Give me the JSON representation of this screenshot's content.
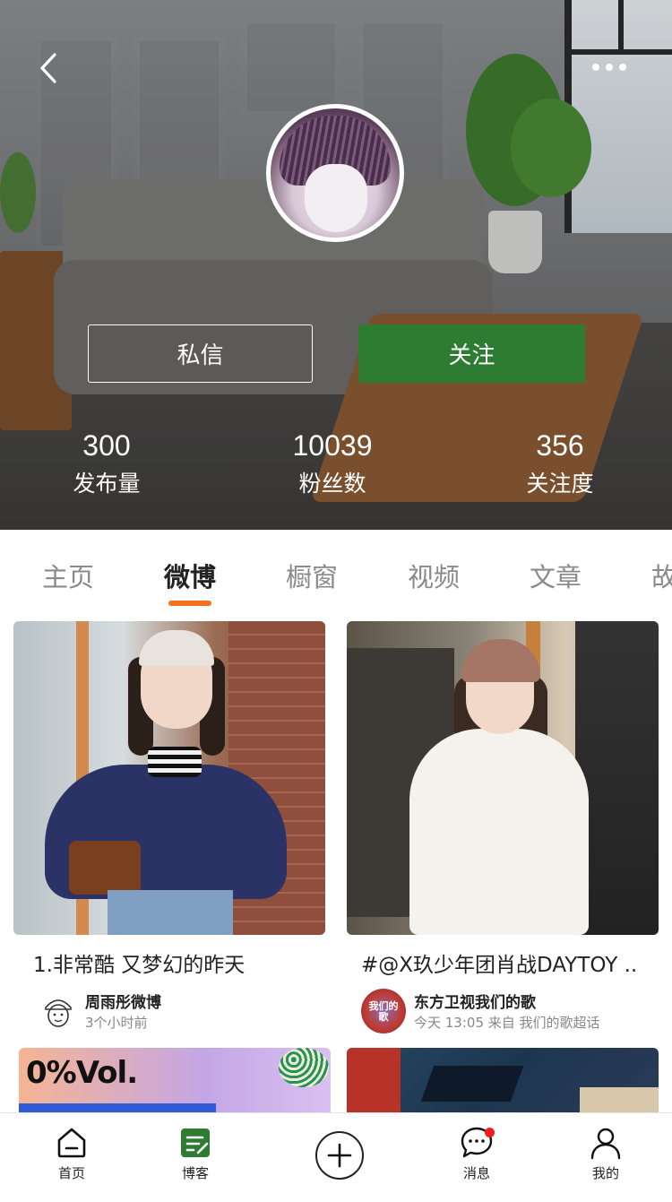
{
  "profile": {
    "message_label": "私信",
    "follow_label": "关注",
    "stats": [
      {
        "value": "300",
        "label": "发布量"
      },
      {
        "value": "10039",
        "label": "粉丝数"
      },
      {
        "value": "356",
        "label": "关注度"
      }
    ]
  },
  "tabs": [
    "主页",
    "微博",
    "橱窗",
    "视频",
    "文章",
    "故"
  ],
  "active_tab": "微博",
  "accent_color": "#f37021",
  "follow_color": "#2e7b32",
  "posts": [
    {
      "title": "1.非常酷 又梦幻的昨天",
      "author": "周雨彤微博",
      "meta": "3个小时前"
    },
    {
      "title": "#@X玖少年团肖战DAYTOY ..",
      "author": "东方卫视我们的歌",
      "meta": "今天 13:05 来自 我们的歌超话",
      "avatar_text": "我们的歌"
    },
    {
      "image_text": "0%Vol."
    },
    {}
  ],
  "bottom_nav": [
    {
      "label": "首页",
      "icon": "home-icon"
    },
    {
      "label": "博客",
      "icon": "blog-icon"
    },
    {
      "label": "",
      "icon": "add-icon"
    },
    {
      "label": "消息",
      "icon": "message-icon"
    },
    {
      "label": "我的",
      "icon": "profile-icon"
    }
  ]
}
